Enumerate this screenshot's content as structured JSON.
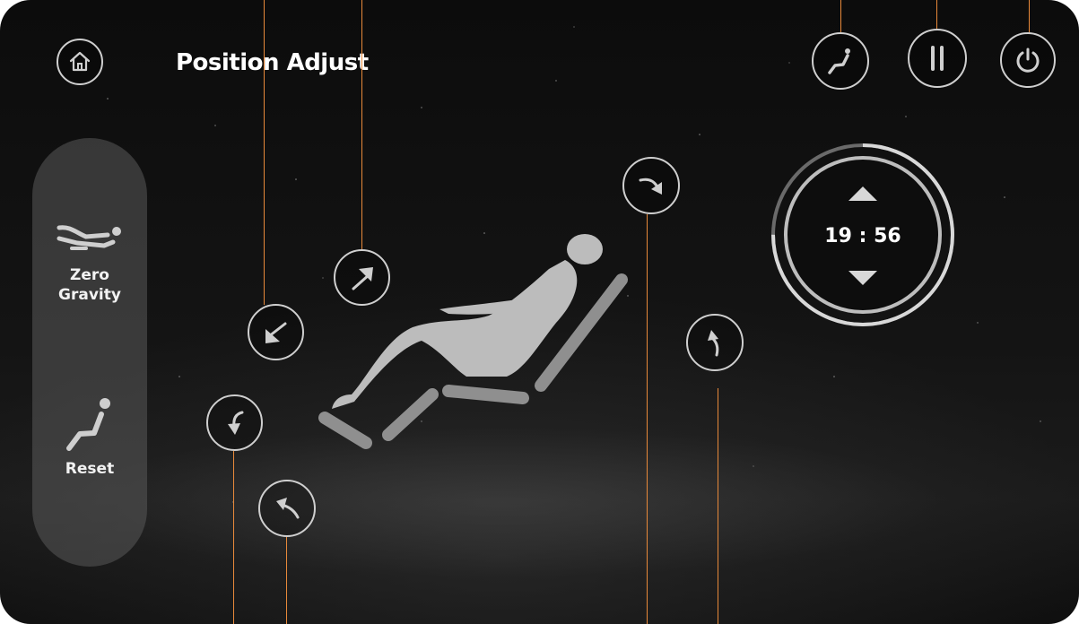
{
  "header": {
    "title": "Position Adjust",
    "home_icon": "home-icon",
    "chair_icon": "recline-chair-icon",
    "pause_icon": "pause-icon",
    "power_icon": "power-icon"
  },
  "sidebar": {
    "items": [
      {
        "label_line1": "Zero",
        "label_line2": "Gravity",
        "icon": "zero-gravity-icon"
      },
      {
        "label_line1": "Reset",
        "icon": "reset-chair-icon"
      }
    ]
  },
  "timer": {
    "minutes": "19",
    "separator": ":",
    "seconds": "56",
    "progress": 0.75
  },
  "adjust_buttons": [
    {
      "name": "backrest-up",
      "icon": "arrow-up-right-icon"
    },
    {
      "name": "backrest-down",
      "icon": "arrow-down-left-icon"
    },
    {
      "name": "legrest-up",
      "icon": "curved-arrow-down-icon"
    },
    {
      "name": "legrest-down",
      "icon": "curved-arrow-back-icon"
    },
    {
      "name": "recline-forward",
      "icon": "curved-arrow-right-icon"
    },
    {
      "name": "recline-back",
      "icon": "curved-arrow-up-icon"
    }
  ],
  "colors": {
    "accent": "#e8893a",
    "icon": "#cfcfcf",
    "panel": "#5a5a5a"
  }
}
